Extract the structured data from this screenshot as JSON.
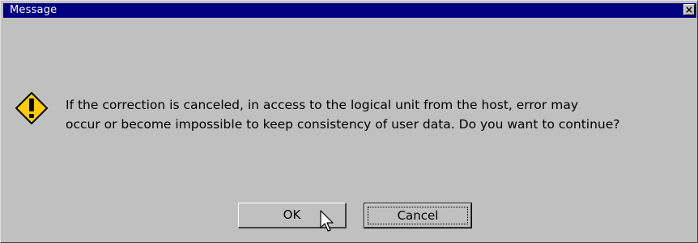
{
  "window": {
    "title": "Message",
    "close_glyph": "×"
  },
  "message": {
    "line1": "If the correction is canceled, in access to the logical unit from the host, error may",
    "line2": "occur or become impossible to keep consistency of user data. Do you want to continue?",
    "icon": "warning-icon"
  },
  "buttons": {
    "ok_label": "OK",
    "cancel_label": "Cancel"
  },
  "colors": {
    "titlebar": "#000080",
    "dialog_bg": "#c0c0c0",
    "icon_fill": "#ffcc00"
  }
}
